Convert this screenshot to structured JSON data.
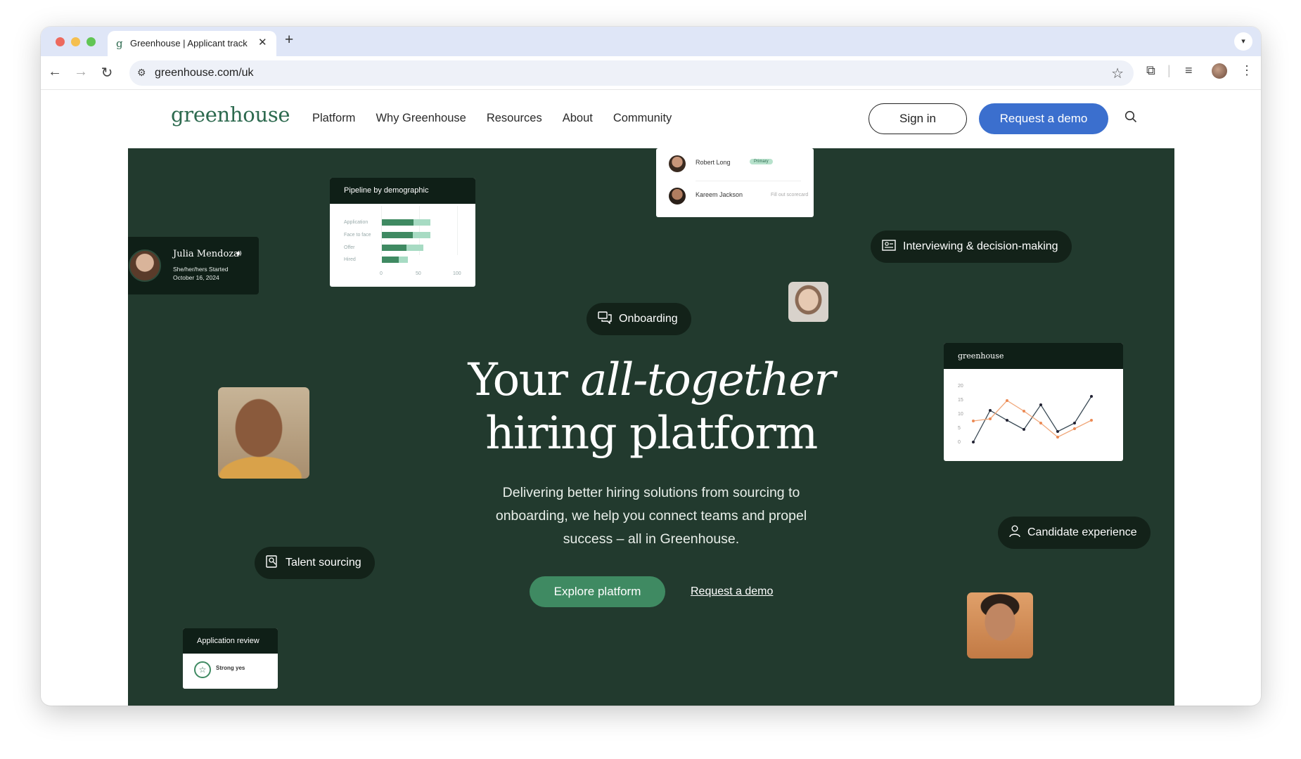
{
  "browser": {
    "tab_title": "Greenhouse | Applicant track",
    "url": "greenhouse.com/uk",
    "traffic_lights": [
      "#ed6a5e",
      "#f5bf4f",
      "#61c554"
    ]
  },
  "nav": {
    "logo": "greenhouse",
    "menu": [
      "Platform",
      "Why Greenhouse",
      "Resources",
      "About",
      "Community"
    ],
    "sign_in": "Sign in",
    "request_demo": "Request a demo"
  },
  "hero": {
    "title_pre": "Your ",
    "title_italic": "all-together",
    "title_line2": "hiring platform",
    "subtitle": "Delivering better hiring solutions from sourcing to onboarding, we help you connect teams and propel success – all in Greenhouse.",
    "cta_primary": "Explore platform",
    "cta_secondary": "Request a demo",
    "pills": {
      "interviewing": "Interviewing & decision-making",
      "onboarding": "Onboarding",
      "candidate": "Candidate experience",
      "talent": "Talent sourcing"
    },
    "julia": {
      "name": "Julia Mendoza",
      "meta": "She/her/hers  Started October 16, 2024"
    },
    "pipeline": {
      "title": "Pipeline by demographic",
      "rows": [
        "Application",
        "Face to face",
        "Offer",
        "Hired"
      ],
      "axis": [
        "0",
        "50",
        "100"
      ]
    },
    "reviewers": [
      {
        "name": "Robert Long",
        "tag": "Primary",
        "note": ""
      },
      {
        "name": "Kareem Jackson",
        "tag": "",
        "note": "Fill out scorecard"
      }
    ],
    "linechart": {
      "brand": "greenhouse",
      "yticks": [
        "20",
        "15",
        "10",
        "5",
        "0"
      ]
    },
    "app_review": {
      "title": "Application review",
      "value": "Strong yes"
    }
  },
  "colors": {
    "hero_bg": "#223a2e",
    "brand_green": "#2d6a4f",
    "button_blue": "#3b6fce",
    "cta_green": "#3f8a62"
  }
}
